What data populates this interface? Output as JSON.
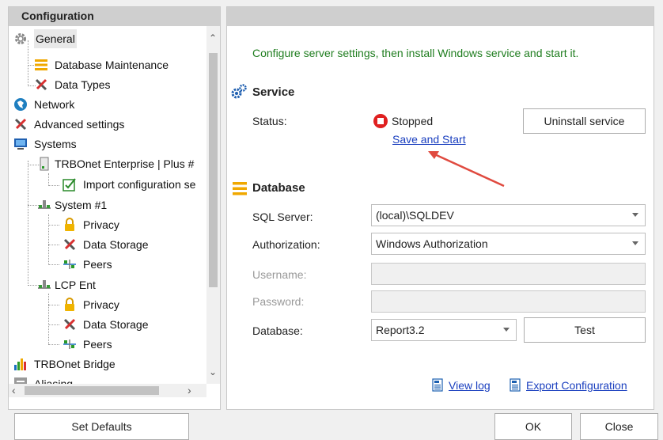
{
  "left_panel": {
    "title": "Configuration",
    "tree": [
      {
        "label": "General",
        "icon": "gear-icon"
      },
      {
        "label": "Database Maintenance",
        "icon": "database-stack-icon"
      },
      {
        "label": "Data Types",
        "icon": "tools-icon"
      },
      {
        "label": "Network",
        "icon": "network-globe-icon"
      },
      {
        "label": "Advanced settings",
        "icon": "tools-icon"
      },
      {
        "label": "Systems",
        "icon": "monitor-icon"
      },
      {
        "label": "TRBOnet Enterprise | Plus #",
        "icon": "server-icon"
      },
      {
        "label": "Import configuration se",
        "icon": "import-checkbox-icon"
      },
      {
        "label": "System #1",
        "icon": "system-network-icon"
      },
      {
        "label": "Privacy",
        "icon": "lock-icon"
      },
      {
        "label": "Data Storage",
        "icon": "tools-icon"
      },
      {
        "label": "Peers",
        "icon": "peers-icon"
      },
      {
        "label": "LCP Ent",
        "icon": "system-network-icon"
      },
      {
        "label": "Privacy",
        "icon": "lock-icon"
      },
      {
        "label": "Data Storage",
        "icon": "tools-icon"
      },
      {
        "label": "Peers",
        "icon": "peers-icon"
      },
      {
        "label": "TRBOnet Bridge",
        "icon": "bridge-bars-icon"
      },
      {
        "label": "Aliasing",
        "icon": "aliasing-icon"
      }
    ]
  },
  "right_panel": {
    "hint": "Configure server settings, then install Windows service and start it.",
    "service": {
      "title": "Service",
      "status_label": "Status:",
      "status_value": "Stopped",
      "save_start_link": "Save and Start",
      "uninstall_button": "Uninstall service"
    },
    "database": {
      "title": "Database",
      "sql_server_label": "SQL Server:",
      "sql_server_value": "(local)\\SQLDEV",
      "authorization_label": "Authorization:",
      "authorization_value": "Windows Authorization",
      "username_label": "Username:",
      "username_value": "",
      "password_label": "Password:",
      "password_value": "",
      "database_label": "Database:",
      "database_value": "Report3.2",
      "test_button": "Test"
    },
    "links": {
      "view_log": "View log",
      "export_configuration": "Export Configuration"
    }
  },
  "footer": {
    "set_defaults": "Set Defaults",
    "ok": "OK",
    "close": "Close"
  },
  "colors": {
    "hint_green": "#1f7d1f",
    "link_blue": "#1a3fbf",
    "stopped_red": "#e02020",
    "annotation_arrow": "#e04a3f"
  }
}
